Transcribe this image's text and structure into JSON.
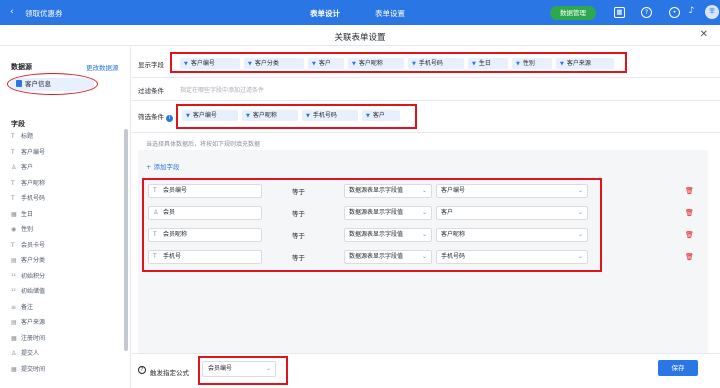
{
  "topbar": {
    "back_icon": "chevron-left-icon",
    "app_title": "领取优惠券",
    "tabs": [
      {
        "label": "表单设计",
        "active": true
      },
      {
        "label": "表单设置",
        "active": false
      }
    ],
    "data_manage_label": "数据管理",
    "avatar_text": "菲",
    "accent_color": "#2b76e5",
    "green_color": "#2ea84f"
  },
  "dialog": {
    "title": "关联表单设置",
    "close_icon": "close-icon"
  },
  "sidebar": {
    "datasource_label": "数据源",
    "change_datasource_label": "更改数据源",
    "datasource_item": "客户信息",
    "fields_label": "字段",
    "fields": [
      {
        "icon": "text-icon",
        "glyph": "T",
        "label": "标题"
      },
      {
        "icon": "text-icon",
        "glyph": "T",
        "label": "客户编号"
      },
      {
        "icon": "user-icon",
        "glyph": "♙",
        "label": "客户"
      },
      {
        "icon": "text-icon",
        "glyph": "T",
        "label": "客户昵称"
      },
      {
        "icon": "text-icon",
        "glyph": "T",
        "label": "手机号码"
      },
      {
        "icon": "calendar-icon",
        "glyph": "▦",
        "label": "生日"
      },
      {
        "icon": "radio-icon",
        "glyph": "◉",
        "label": "性别"
      },
      {
        "icon": "text-icon",
        "glyph": "T",
        "label": "会员卡号"
      },
      {
        "icon": "select-icon",
        "glyph": "▤",
        "label": "客户分类"
      },
      {
        "icon": "number-icon",
        "glyph": "¹²",
        "label": "初始积分"
      },
      {
        "icon": "number-icon",
        "glyph": "¹²",
        "label": "初始储值"
      },
      {
        "icon": "textarea-icon",
        "glyph": "≡",
        "label": "备注"
      },
      {
        "icon": "select-icon",
        "glyph": "▤",
        "label": "客户来源"
      },
      {
        "icon": "calendar-icon",
        "glyph": "▦",
        "label": "注册时间"
      },
      {
        "icon": "user-icon",
        "glyph": "♙",
        "label": "提交人"
      },
      {
        "icon": "calendar-icon",
        "glyph": "▦",
        "label": "提交时间"
      }
    ]
  },
  "display_fields": {
    "label": "显示字段",
    "tags": [
      "客户编号",
      "客户分类",
      "客户",
      "客户昵称",
      "手机号码",
      "生日",
      "性别",
      "客户来源"
    ]
  },
  "filter": {
    "label": "过滤条件",
    "placeholder": "指定在哪些字段中添加过滤条件"
  },
  "search_condition": {
    "label": "筛选条件",
    "tags": [
      "客户编号",
      "客户昵称",
      "手机号码",
      "客户"
    ]
  },
  "fill": {
    "hint": "当选择具体数据后，将按如下规则填充数据",
    "add_field_label": "+ 添加字段",
    "rows": [
      {
        "target_icon": "text-icon",
        "target_glyph": "T",
        "target": "会员编号",
        "operator": "等于",
        "source_type": "数据源表显示字段值",
        "source_field": "客户编号"
      },
      {
        "target_icon": "user-icon",
        "target_glyph": "♙",
        "target": "会员",
        "operator": "等于",
        "source_type": "数据源表显示字段值",
        "source_field": "客户"
      },
      {
        "target_icon": "text-icon",
        "target_glyph": "T",
        "target": "会员昵称",
        "operator": "等于",
        "source_type": "数据源表显示字段值",
        "source_field": "客户昵称"
      },
      {
        "target_icon": "text-icon",
        "target_glyph": "T",
        "target": "手机号",
        "operator": "等于",
        "source_type": "数据源表显示字段值",
        "source_field": "手机号码"
      }
    ]
  },
  "footer": {
    "trigger_label": "触发指定公式",
    "trigger_value": "会员编号",
    "save_label": "保存"
  },
  "annotation_color": "#e0141e"
}
